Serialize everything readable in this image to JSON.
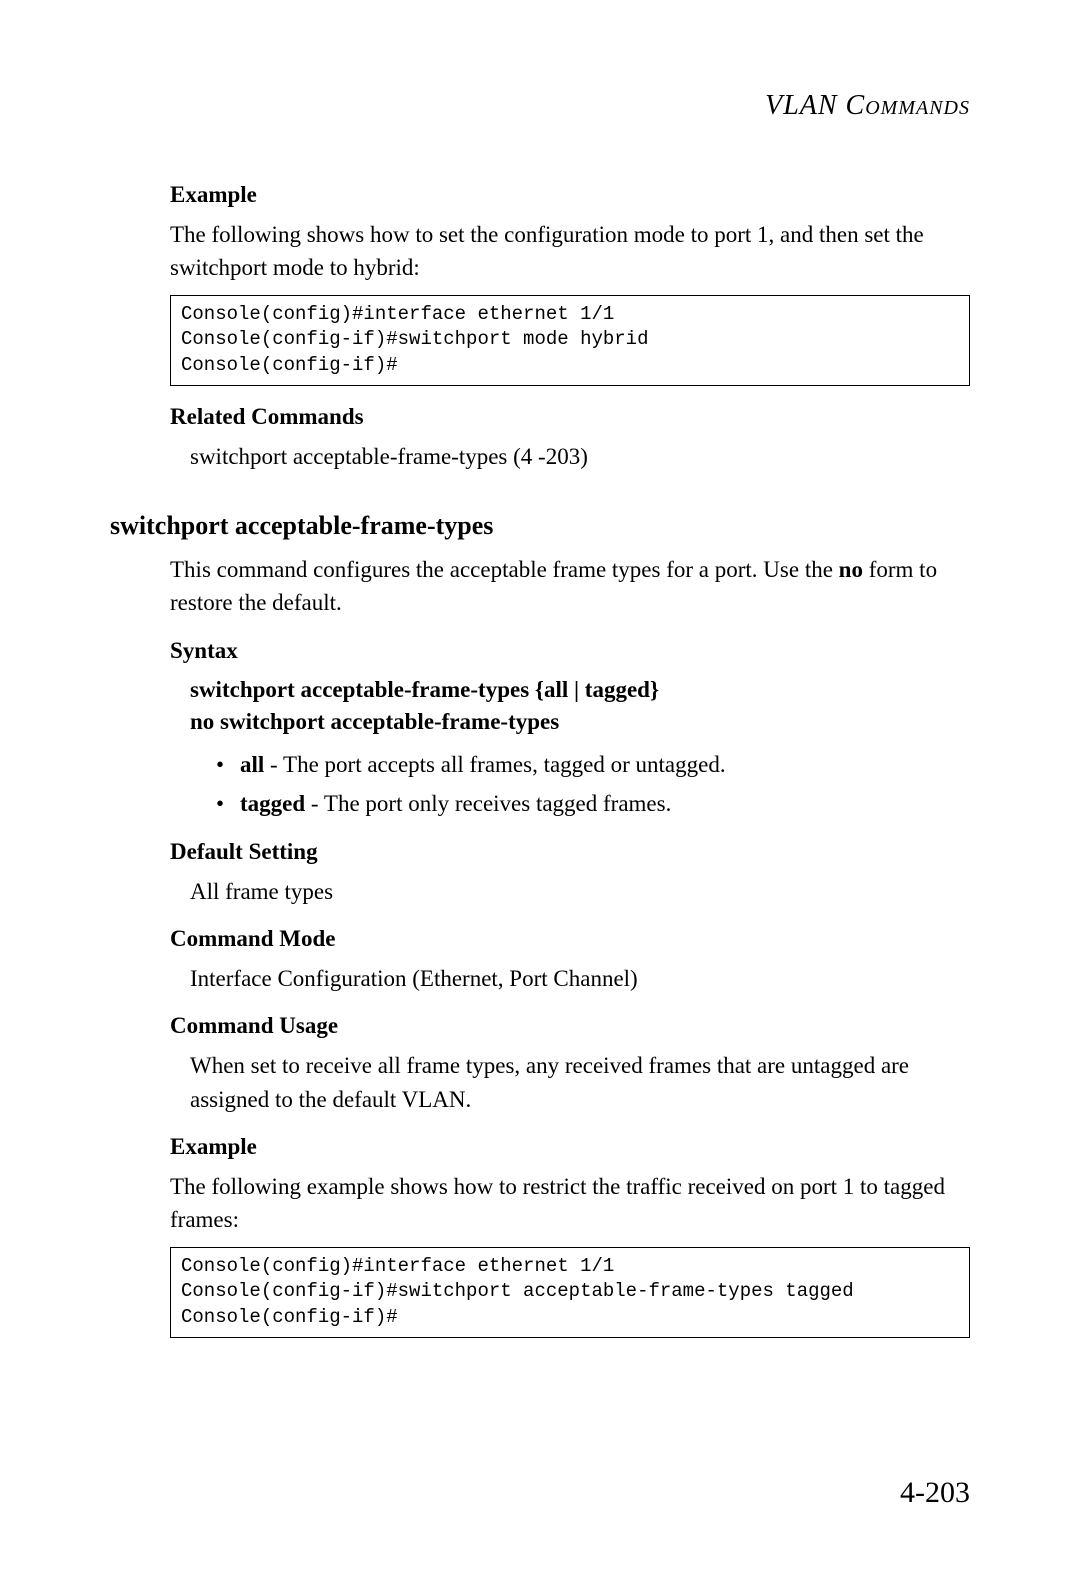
{
  "header": {
    "title": "VLAN Commands"
  },
  "section1": {
    "example_head": "Example",
    "example_text": "The following shows how to set the configuration mode to port 1, and then set the switchport mode to hybrid:",
    "code": "Console(config)#interface ethernet 1/1\nConsole(config-if)#switchport mode hybrid\nConsole(config-if)#",
    "related_head": "Related Commands",
    "related_text": "switchport acceptable-frame-types (4 -203)"
  },
  "section2": {
    "heading": "switchport acceptable-frame-types",
    "intro_pre": "This command configures the acceptable frame types for a port. Use the ",
    "intro_bold": "no",
    "intro_post": " form to restore the default.",
    "syntax_head": "Syntax",
    "syntax_line1": "switchport acceptable-frame-types {all | tagged}",
    "syntax_line2": "no switchport acceptable-frame-types",
    "bullets": [
      {
        "term": "all",
        "desc": " - The port accepts all frames, tagged or untagged."
      },
      {
        "term": "tagged",
        "desc": " - The port only receives tagged frames."
      }
    ],
    "default_head": "Default Setting",
    "default_text": "All frame types",
    "mode_head": "Command Mode",
    "mode_text": "Interface Configuration (Ethernet, Port Channel)",
    "usage_head": "Command Usage",
    "usage_text": "When set to receive all frame types, any received frames that are untagged are assigned to the default VLAN.",
    "example_head": "Example",
    "example_text": "The following example shows how to restrict the traffic received on port 1 to tagged frames:",
    "code": "Console(config)#interface ethernet 1/1\nConsole(config-if)#switchport acceptable-frame-types tagged\nConsole(config-if)#"
  },
  "page_number": "4-203"
}
